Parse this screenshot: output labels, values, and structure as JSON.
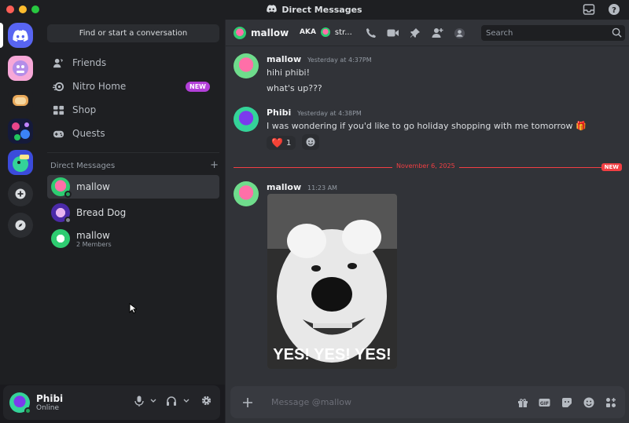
{
  "titlebar": {
    "title": "Direct Messages"
  },
  "sidebar": {
    "find_label": "Find or start a conversation",
    "nav": [
      {
        "label": "Friends"
      },
      {
        "label": "Nitro Home",
        "badge": "NEW"
      },
      {
        "label": "Shop"
      },
      {
        "label": "Quests"
      }
    ],
    "dm_header": "Direct Messages",
    "dm_add": "+",
    "dms": [
      {
        "name": "mallow",
        "sub": "",
        "status": "online"
      },
      {
        "name": "Bread Dog",
        "sub": "",
        "status": "offline"
      },
      {
        "name": "mallow",
        "sub": "2 Members",
        "status": "online"
      }
    ]
  },
  "user": {
    "name": "Phibi",
    "status": "Online"
  },
  "header": {
    "name": "mallow",
    "aka_label": "AKA",
    "aka_name": "str..."
  },
  "search": {
    "placeholder": "Search"
  },
  "messages": [
    {
      "author": "mallow",
      "time": "Yesterday at 4:37PM",
      "lines": [
        "hihi phibi!",
        "what's up???"
      ]
    },
    {
      "author": "Phibi",
      "time": "Yesterday at 4:38PM",
      "lines": [
        "I was wondering if you'd like to go holiday shopping with me tomorrow 🎁"
      ],
      "reaction": {
        "emoji": "❤️",
        "count": "1"
      }
    },
    {
      "author": "mallow",
      "time": "11:23 AM",
      "gif_caption": "YES! YES! YES!"
    }
  ],
  "date_separator": {
    "label": "November 6, 2025",
    "new": "NEW"
  },
  "composer": {
    "placeholder": "Message @mallow"
  },
  "colors": {
    "accent": "#5865f2",
    "online": "#23a55a",
    "new_line": "#f23f43",
    "nitro_badge": "#b33fd9"
  }
}
